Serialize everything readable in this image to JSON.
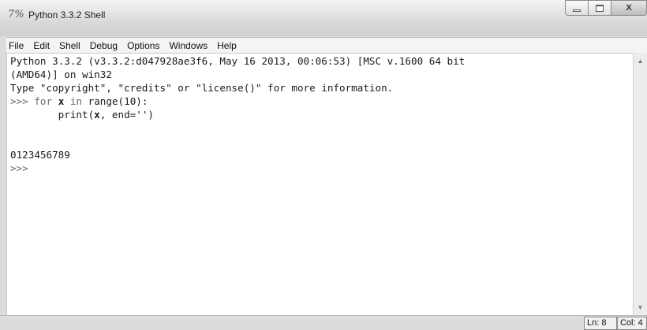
{
  "window": {
    "title": "Python 3.3.2 Shell",
    "app_icon": "idle-logo-icon",
    "controls": {
      "minimize": "minimize-icon",
      "maximize": "maximize-icon",
      "close_label": "X"
    }
  },
  "menu": {
    "items": [
      "File",
      "Edit",
      "Shell",
      "Debug",
      "Options",
      "Windows",
      "Help"
    ]
  },
  "shell": {
    "lines": [
      {
        "parts": [
          {
            "text": "Python 3.3.2 (v3.3.2:d047928ae3f6, May 16 2013, 00:06:53) [MSC v.1600 64 bit"
          }
        ]
      },
      {
        "parts": [
          {
            "text": "(AMD64)] on win32"
          }
        ]
      },
      {
        "parts": [
          {
            "text": "Type \"copyright\", \"credits\" or \"license()\" for more information."
          }
        ]
      },
      {
        "parts": [
          {
            "text": ">>> ",
            "style": "prompt"
          },
          {
            "text": "for ",
            "style": "kw"
          },
          {
            "text": "x",
            "style": "bold"
          },
          {
            "text": " in ",
            "style": "kw"
          },
          {
            "text": "range(10):"
          }
        ]
      },
      {
        "parts": [
          {
            "text": "        print("
          },
          {
            "text": "x",
            "style": "bold"
          },
          {
            "text": ", end='')"
          }
        ]
      },
      {
        "parts": [
          {
            "text": ""
          }
        ]
      },
      {
        "parts": [
          {
            "text": ""
          }
        ]
      },
      {
        "parts": [
          {
            "text": "0123456789"
          }
        ]
      },
      {
        "parts": [
          {
            "text": ">>>",
            "style": "prompt"
          }
        ]
      }
    ]
  },
  "status": {
    "line": "Ln: 8",
    "col": "Col: 4"
  }
}
